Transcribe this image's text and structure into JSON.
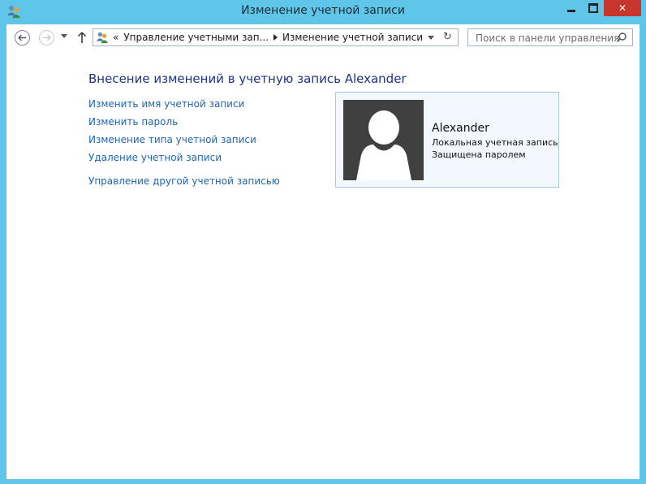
{
  "window": {
    "title": "Изменение учетной записи",
    "icon": "user-accounts-icon",
    "close_color": "#c7352c"
  },
  "nav": {
    "back_icon": "back-arrow-icon",
    "forward_icon": "forward-arrow-icon",
    "recent_icon": "chevron-down-icon",
    "up_icon": "up-arrow-icon"
  },
  "address": {
    "overflow": "«",
    "crumb1": "Управление учетными зап...",
    "crumb2": "Изменение учетной записи"
  },
  "search": {
    "placeholder": "Поиск в панели управления"
  },
  "main": {
    "heading": "Внесение изменений в учетную запись Alexander",
    "links": [
      "Изменить имя учетной записи",
      "Изменить пароль",
      "Изменение типа учетной записи",
      "Удаление учетной записи",
      "Управление другой учетной записью"
    ]
  },
  "user": {
    "name": "Alexander",
    "type": "Локальная учетная запись",
    "status": "Защищена паролем"
  },
  "colors": {
    "frame": "#5fc6ea",
    "heading": "#1e3287",
    "link": "#1e66b0",
    "card_bg": "#f2f8fd"
  }
}
